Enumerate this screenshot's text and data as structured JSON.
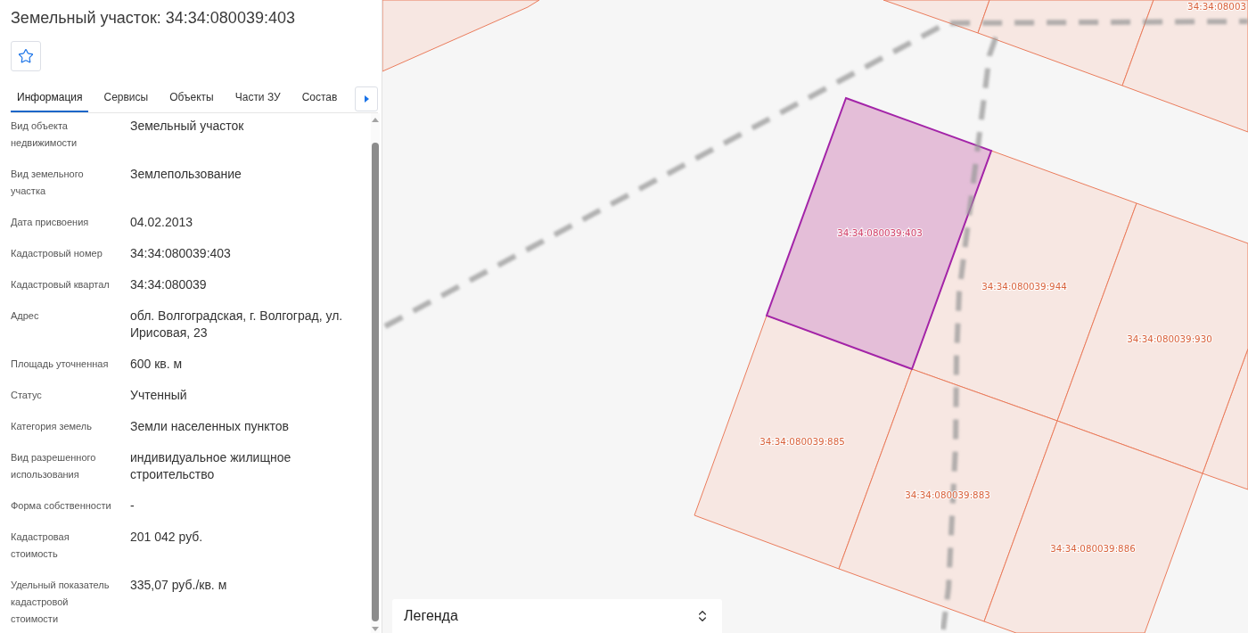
{
  "panel": {
    "title": "Земельный участок: 34:34:080039:403",
    "starred": false
  },
  "tabs": [
    {
      "label": "Информация",
      "selected": true
    },
    {
      "label": "Сервисы",
      "selected": false
    },
    {
      "label": "Объекты",
      "selected": false
    },
    {
      "label": "Части ЗУ",
      "selected": false
    },
    {
      "label": "Состав",
      "selected": false
    }
  ],
  "fields": [
    {
      "label": "Вид объекта недвижимости",
      "value": "Земельный участок"
    },
    {
      "label": "Вид земельного участка",
      "value": "Землепользование"
    },
    {
      "label": "Дата присвоения",
      "value": "04.02.2013"
    },
    {
      "label": "Кадастровый номер",
      "value": "34:34:080039:403"
    },
    {
      "label": "Кадастровый квартал",
      "value": "34:34:080039"
    },
    {
      "label": "Адрес",
      "value": "обл. Волгоградская, г. Волгоград, ул. Ирисовая, 23"
    },
    {
      "label": "Площадь уточненная",
      "value": "600 кв. м"
    },
    {
      "label": "Статус",
      "value": "Учтенный"
    },
    {
      "label": "Категория земель",
      "value": "Земли населенных пунктов"
    },
    {
      "label": "Вид разрешенного использования",
      "value": "индивидуальное жилищное строительство"
    },
    {
      "label": "Форма собственности",
      "value": "-"
    },
    {
      "label": "Кадастровая стоимость",
      "value": "201 042 руб."
    },
    {
      "label": "Удельный показатель кадастровой стоимости",
      "value": "335,07 руб./кв. м"
    }
  ],
  "map": {
    "parcels": [
      {
        "label": "34:34:08003",
        "selected": false
      },
      {
        "label": "34:34:080039:403",
        "selected": true
      },
      {
        "label": "34:34:080039:944",
        "selected": false
      },
      {
        "label": "34:34:080039:930",
        "selected": false
      },
      {
        "label": "34:34:080039:885",
        "selected": false
      },
      {
        "label": "34:34:080039:883",
        "selected": false
      },
      {
        "label": "34:34:080039:886",
        "selected": false
      }
    ],
    "legend": {
      "label": "Легенда"
    }
  }
}
